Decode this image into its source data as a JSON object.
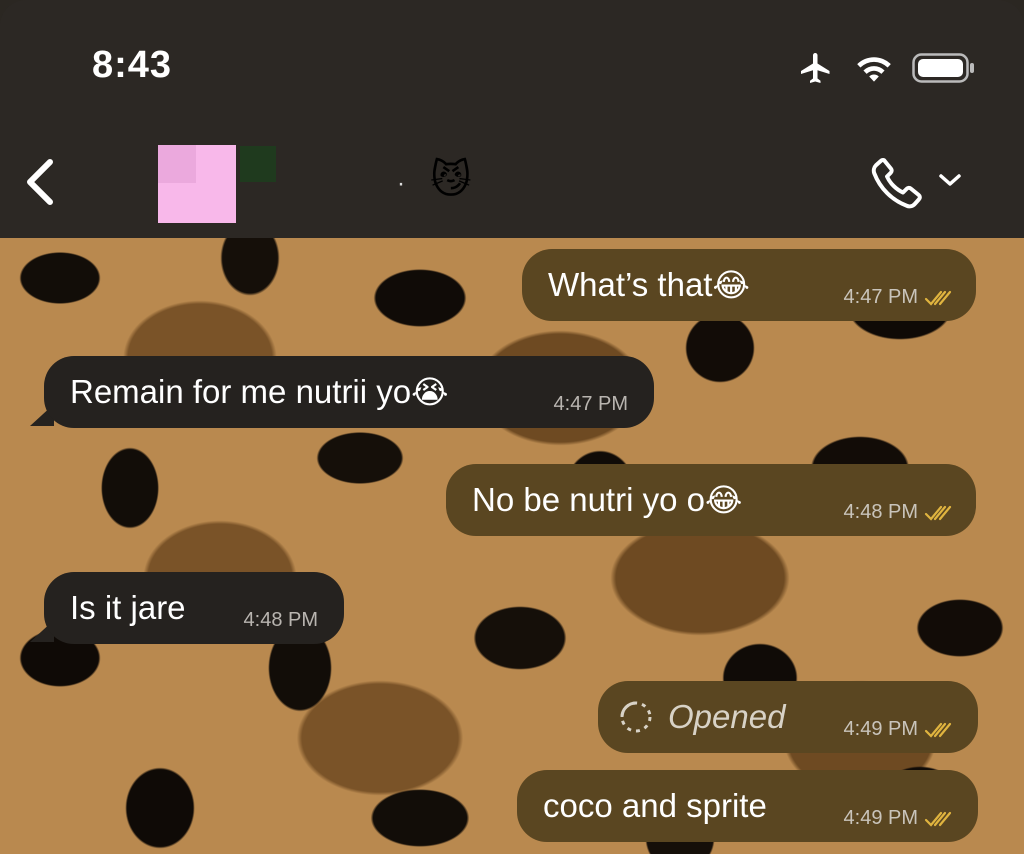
{
  "status_bar": {
    "time": "8:43",
    "icons": [
      "airplane-icon",
      "wifi-icon",
      "battery-icon"
    ]
  },
  "header": {
    "back_icon": "chevron-left-icon",
    "contact_name_mark": "·",
    "contact_emoji": "😼",
    "call_icon": "phone-icon",
    "call_menu_icon": "chevron-down-icon"
  },
  "messages": [
    {
      "direction": "out",
      "text": "What’s that ",
      "emoji": "😂",
      "time": "4:47 PM",
      "status": "read"
    },
    {
      "direction": "in",
      "text": "Remain for me nutrii yo",
      "emoji": "😭",
      "time": "4:47 PM"
    },
    {
      "direction": "out",
      "text": "No be nutri yo o ",
      "emoji": "😂",
      "time": "4:48 PM",
      "status": "read"
    },
    {
      "direction": "in",
      "text": "Is it jare",
      "time": "4:48 PM"
    },
    {
      "direction": "out",
      "text": "Opened",
      "icon": "view-once-icon",
      "time": "4:49 PM",
      "status": "read"
    },
    {
      "direction": "out",
      "text": "coco and sprite",
      "time": "4:49 PM",
      "status": "read"
    }
  ],
  "colors": {
    "header_bg": "#2c2824",
    "outgoing_bubble": "#5a4621",
    "incoming_bubble": "#25221f",
    "read_check": "#e0b43f"
  }
}
